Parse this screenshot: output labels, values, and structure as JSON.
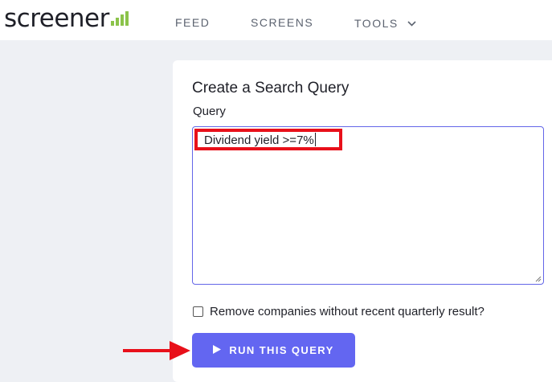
{
  "header": {
    "logo_text": "screener",
    "nav": [
      {
        "label": "FEED"
      },
      {
        "label": "SCREENS"
      },
      {
        "label": "TOOLS"
      }
    ]
  },
  "main": {
    "title": "Create a Search Query",
    "query_label": "Query",
    "query_value": "Dividend yield >=7%",
    "remove_checkbox_label": "Remove companies without recent quarterly result?",
    "remove_checkbox_checked": false,
    "run_button_label": "RUN THIS QUERY"
  },
  "colors": {
    "accent": "#6366f1",
    "logo_bars": "#8bc34a",
    "annotation_red": "#e8101a"
  }
}
